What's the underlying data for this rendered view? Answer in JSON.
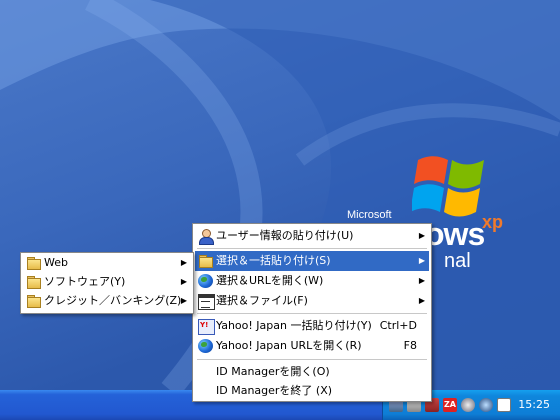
{
  "desktop": {
    "wordmark_company": "Microsoft",
    "wordmark_product": "ows",
    "wordmark_xp": "xp",
    "wordmark_edition": "nal"
  },
  "main_menu": {
    "items": [
      {
        "label": "ユーザー情報の貼り付け(U)",
        "icon": "user-icon",
        "submenu": true
      },
      {
        "label": "選択＆一括貼り付け(S)",
        "icon": "folder-icon",
        "submenu": true,
        "highlighted": true
      },
      {
        "label": "選択＆URLを開く(W)",
        "icon": "globe-icon",
        "submenu": true
      },
      {
        "label": "選択＆ファイル(F)",
        "icon": "file-window-icon",
        "submenu": true
      },
      {
        "label": "Yahoo! Japan 一括貼り付け(Y)",
        "icon": "yahoo-doc-icon",
        "shortcut": "Ctrl+D"
      },
      {
        "label": "Yahoo! Japan URLを開く(R)",
        "icon": "globe-icon",
        "shortcut": "F8"
      },
      {
        "label": "ID Managerを開く(O)"
      },
      {
        "label": "ID Managerを終了 (X)"
      }
    ]
  },
  "sub_menu": {
    "items": [
      {
        "label": "Web",
        "icon": "folder-icon",
        "submenu": true
      },
      {
        "label": "ソフトウェア(Y)",
        "icon": "folder-icon",
        "submenu": true
      },
      {
        "label": "クレジット／バンキング(Z)",
        "icon": "folder-icon",
        "submenu": true
      }
    ]
  },
  "taskbar": {
    "clock": "15:25",
    "tray_icons": [
      "network-icon",
      "app-icon",
      "shield-icon",
      "zonealarm-icon",
      "antivirus-icon",
      "security-icon",
      "calendar-icon"
    ]
  },
  "colors": {
    "menu_highlight": "#316ac5",
    "taskbar_blue": "#2258d0",
    "tray_blue": "#0f86dc"
  }
}
